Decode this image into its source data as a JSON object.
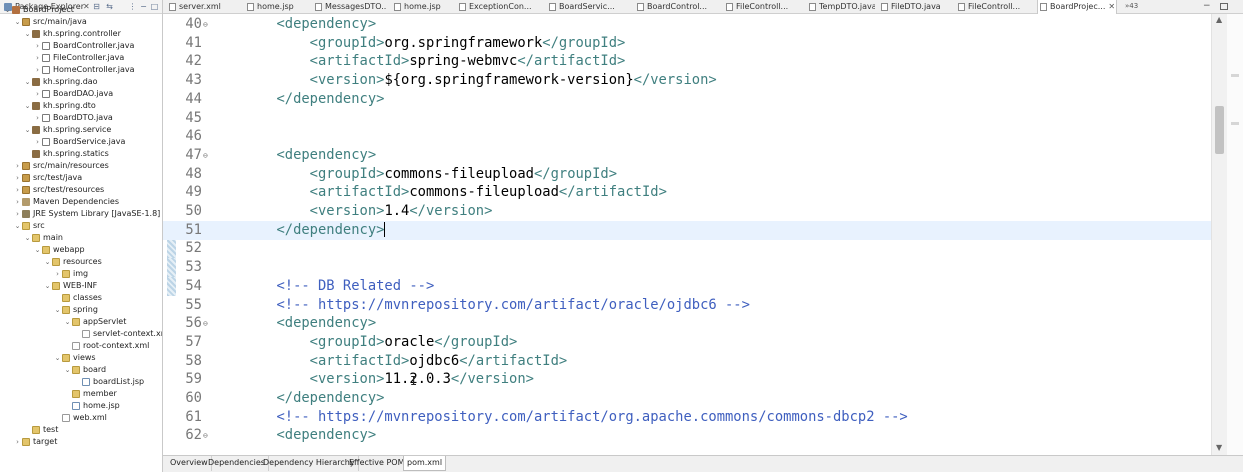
{
  "explorer": {
    "title": "Package Explorer",
    "close": "✕",
    "toolbar": [
      "collapse-all-icon",
      "link-editor-icon",
      "filter-icon",
      "view-menu-icon"
    ],
    "tree": [
      {
        "label": "BoardProject",
        "depth": 0,
        "expanded": true,
        "icon": "project-icon"
      },
      {
        "label": "src/main/java",
        "depth": 1,
        "expanded": true,
        "icon": "source-folder-icon"
      },
      {
        "label": "kh.spring.controller",
        "depth": 2,
        "expanded": true,
        "icon": "package-icon"
      },
      {
        "label": "BoardController.java",
        "depth": 3,
        "expanded": false,
        "icon": "java-file-icon"
      },
      {
        "label": "FileController.java",
        "depth": 3,
        "expanded": false,
        "icon": "java-file-icon"
      },
      {
        "label": "HomeController.java",
        "depth": 3,
        "expanded": false,
        "icon": "java-file-icon"
      },
      {
        "label": "kh.spring.dao",
        "depth": 2,
        "expanded": true,
        "icon": "package-icon"
      },
      {
        "label": "BoardDAO.java",
        "depth": 3,
        "expanded": false,
        "icon": "java-file-icon"
      },
      {
        "label": "kh.spring.dto",
        "depth": 2,
        "expanded": true,
        "icon": "package-icon"
      },
      {
        "label": "BoardDTO.java",
        "depth": 3,
        "expanded": false,
        "icon": "java-file-icon"
      },
      {
        "label": "kh.spring.service",
        "depth": 2,
        "expanded": true,
        "icon": "package-icon"
      },
      {
        "label": "BoardService.java",
        "depth": 3,
        "expanded": false,
        "icon": "java-file-icon"
      },
      {
        "label": "kh.spring.statics",
        "depth": 2,
        "expanded": null,
        "icon": "package-icon"
      },
      {
        "label": "src/main/resources",
        "depth": 1,
        "expanded": false,
        "icon": "source-folder-icon"
      },
      {
        "label": "src/test/java",
        "depth": 1,
        "expanded": false,
        "icon": "source-folder-icon"
      },
      {
        "label": "src/test/resources",
        "depth": 1,
        "expanded": false,
        "icon": "source-folder-icon"
      },
      {
        "label": "Maven Dependencies",
        "depth": 1,
        "expanded": false,
        "icon": "library-icon"
      },
      {
        "label": "JRE System Library [JavaSE-1.8]",
        "depth": 1,
        "expanded": false,
        "icon": "jre-library-icon"
      },
      {
        "label": "src",
        "depth": 1,
        "expanded": true,
        "icon": "folder-icon"
      },
      {
        "label": "main",
        "depth": 2,
        "expanded": true,
        "icon": "folder-icon"
      },
      {
        "label": "webapp",
        "depth": 3,
        "expanded": true,
        "icon": "folder-icon"
      },
      {
        "label": "resources",
        "depth": 4,
        "expanded": true,
        "icon": "folder-icon"
      },
      {
        "label": "img",
        "depth": 5,
        "expanded": false,
        "icon": "folder-icon"
      },
      {
        "label": "WEB-INF",
        "depth": 4,
        "expanded": true,
        "icon": "folder-icon"
      },
      {
        "label": "classes",
        "depth": 5,
        "expanded": null,
        "icon": "folder-icon"
      },
      {
        "label": "spring",
        "depth": 5,
        "expanded": true,
        "icon": "folder-icon"
      },
      {
        "label": "appServlet",
        "depth": 6,
        "expanded": true,
        "icon": "folder-icon"
      },
      {
        "label": "servlet-context.xml",
        "depth": 7,
        "expanded": null,
        "icon": "xml-file-icon"
      },
      {
        "label": "root-context.xml",
        "depth": 6,
        "expanded": null,
        "icon": "xml-file-icon"
      },
      {
        "label": "views",
        "depth": 5,
        "expanded": true,
        "icon": "folder-icon"
      },
      {
        "label": "board",
        "depth": 6,
        "expanded": true,
        "icon": "folder-icon"
      },
      {
        "label": "boardList.jsp",
        "depth": 7,
        "expanded": null,
        "icon": "jsp-file-icon"
      },
      {
        "label": "member",
        "depth": 6,
        "expanded": null,
        "icon": "folder-icon"
      },
      {
        "label": "home.jsp",
        "depth": 6,
        "expanded": null,
        "icon": "jsp-file-icon"
      },
      {
        "label": "web.xml",
        "depth": 5,
        "expanded": null,
        "icon": "xml-file-icon"
      },
      {
        "label": "test",
        "depth": 2,
        "expanded": null,
        "icon": "folder-icon"
      },
      {
        "label": "target",
        "depth": 1,
        "expanded": false,
        "icon": "folder-icon"
      }
    ]
  },
  "editor_tabs": [
    {
      "label": "server.xml",
      "active": false,
      "icon": "xml-file-icon"
    },
    {
      "label": "home.jsp",
      "active": false,
      "icon": "jsp-file-icon"
    },
    {
      "label": "MessagesDTO....",
      "active": false,
      "icon": "java-file-icon"
    },
    {
      "label": "home.jsp",
      "active": false,
      "icon": "jsp-file-icon"
    },
    {
      "label": "ExceptionCon...",
      "active": false,
      "icon": "java-file-icon"
    },
    {
      "label": "BoardServic...",
      "active": false,
      "icon": "java-file-icon"
    },
    {
      "label": "BoardControl...",
      "active": false,
      "icon": "java-file-icon"
    },
    {
      "label": "FileControll...",
      "active": false,
      "icon": "java-file-icon"
    },
    {
      "label": "TempDTO.java",
      "active": false,
      "icon": "java-file-icon"
    },
    {
      "label": "FileDTO.java",
      "active": false,
      "icon": "java-file-icon"
    },
    {
      "label": "FileControll...",
      "active": false,
      "icon": "java-file-icon"
    },
    {
      "label": "BoardProjec...",
      "active": true,
      "icon": "maven-pom-icon"
    }
  ],
  "tab_overflow": "»43",
  "code_lines": [
    {
      "n": "40",
      "fold": "⊖",
      "parts": [
        [
          "tag",
          "        <dependency>"
        ]
      ]
    },
    {
      "n": "41",
      "fold": "",
      "parts": [
        [
          "tag",
          "            <groupId>"
        ],
        [
          "txt",
          "org.springframework"
        ],
        [
          "tag",
          "</groupId>"
        ]
      ]
    },
    {
      "n": "42",
      "fold": "",
      "parts": [
        [
          "tag",
          "            <artifactId>"
        ],
        [
          "txt",
          "spring-webmvc"
        ],
        [
          "tag",
          "</artifactId>"
        ]
      ]
    },
    {
      "n": "43",
      "fold": "",
      "parts": [
        [
          "tag",
          "            <version>"
        ],
        [
          "txt",
          "${org.springframework-version}"
        ],
        [
          "tag",
          "</version>"
        ]
      ]
    },
    {
      "n": "44",
      "fold": "",
      "parts": [
        [
          "tag",
          "        </dependency>"
        ]
      ]
    },
    {
      "n": "45",
      "fold": "",
      "parts": []
    },
    {
      "n": "46",
      "fold": "",
      "parts": []
    },
    {
      "n": "47",
      "fold": "⊖",
      "parts": [
        [
          "tag",
          "        <dependency>"
        ]
      ]
    },
    {
      "n": "48",
      "fold": "",
      "parts": [
        [
          "tag",
          "            <groupId>"
        ],
        [
          "txt",
          "commons-fileupload"
        ],
        [
          "tag",
          "</groupId>"
        ]
      ]
    },
    {
      "n": "49",
      "fold": "",
      "parts": [
        [
          "tag",
          "            <artifactId>"
        ],
        [
          "txt",
          "commons-fileupload"
        ],
        [
          "tag",
          "</artifactId>"
        ]
      ]
    },
    {
      "n": "50",
      "fold": "",
      "parts": [
        [
          "tag",
          "            <version>"
        ],
        [
          "txt",
          "1.4"
        ],
        [
          "tag",
          "</version>"
        ]
      ]
    },
    {
      "n": "51",
      "fold": "",
      "current": true,
      "parts": [
        [
          "tag",
          "        </dependency>"
        ]
      ]
    },
    {
      "n": "52",
      "fold": "",
      "parts": []
    },
    {
      "n": "53",
      "fold": "",
      "parts": []
    },
    {
      "n": "54",
      "fold": "",
      "parts": [
        [
          "cmt",
          "        <!-- DB Related -->"
        ]
      ]
    },
    {
      "n": "55",
      "fold": "",
      "parts": [
        [
          "cmt",
          "        <!-- https://mvnrepository.com/artifact/oracle/ojdbc6 -->"
        ]
      ]
    },
    {
      "n": "56",
      "fold": "⊖",
      "parts": [
        [
          "tag",
          "        <dependency>"
        ]
      ]
    },
    {
      "n": "57",
      "fold": "",
      "parts": [
        [
          "tag",
          "            <groupId>"
        ],
        [
          "txt",
          "oracle"
        ],
        [
          "tag",
          "</groupId>"
        ]
      ]
    },
    {
      "n": "58",
      "fold": "",
      "parts": [
        [
          "tag",
          "            <artifactId>"
        ],
        [
          "txt",
          "ojdbc6"
        ],
        [
          "tag",
          "</artifactId>"
        ]
      ]
    },
    {
      "n": "59",
      "fold": "",
      "parts": [
        [
          "tag",
          "            <version>"
        ],
        [
          "txt",
          "11.2.0.3"
        ],
        [
          "tag",
          "</version>"
        ]
      ]
    },
    {
      "n": "60",
      "fold": "",
      "parts": [
        [
          "tag",
          "        </dependency>"
        ]
      ]
    },
    {
      "n": "61",
      "fold": "",
      "parts": [
        [
          "cmt",
          "        <!-- https://mvnrepository.com/artifact/org.apache.commons/commons-dbcp2 -->"
        ]
      ]
    },
    {
      "n": "62",
      "fold": "⊖",
      "parts": [
        [
          "tag",
          "        <dependency>"
        ]
      ]
    }
  ],
  "change_lines": [
    "51",
    "52",
    "53",
    "54"
  ],
  "bottom_tabs": [
    {
      "label": "Overview",
      "active": false
    },
    {
      "label": "Dependencies",
      "active": false
    },
    {
      "label": "Dependency Hierarchy",
      "active": false
    },
    {
      "label": "Effective POM",
      "active": false
    },
    {
      "label": "pom.xml",
      "active": true
    }
  ]
}
